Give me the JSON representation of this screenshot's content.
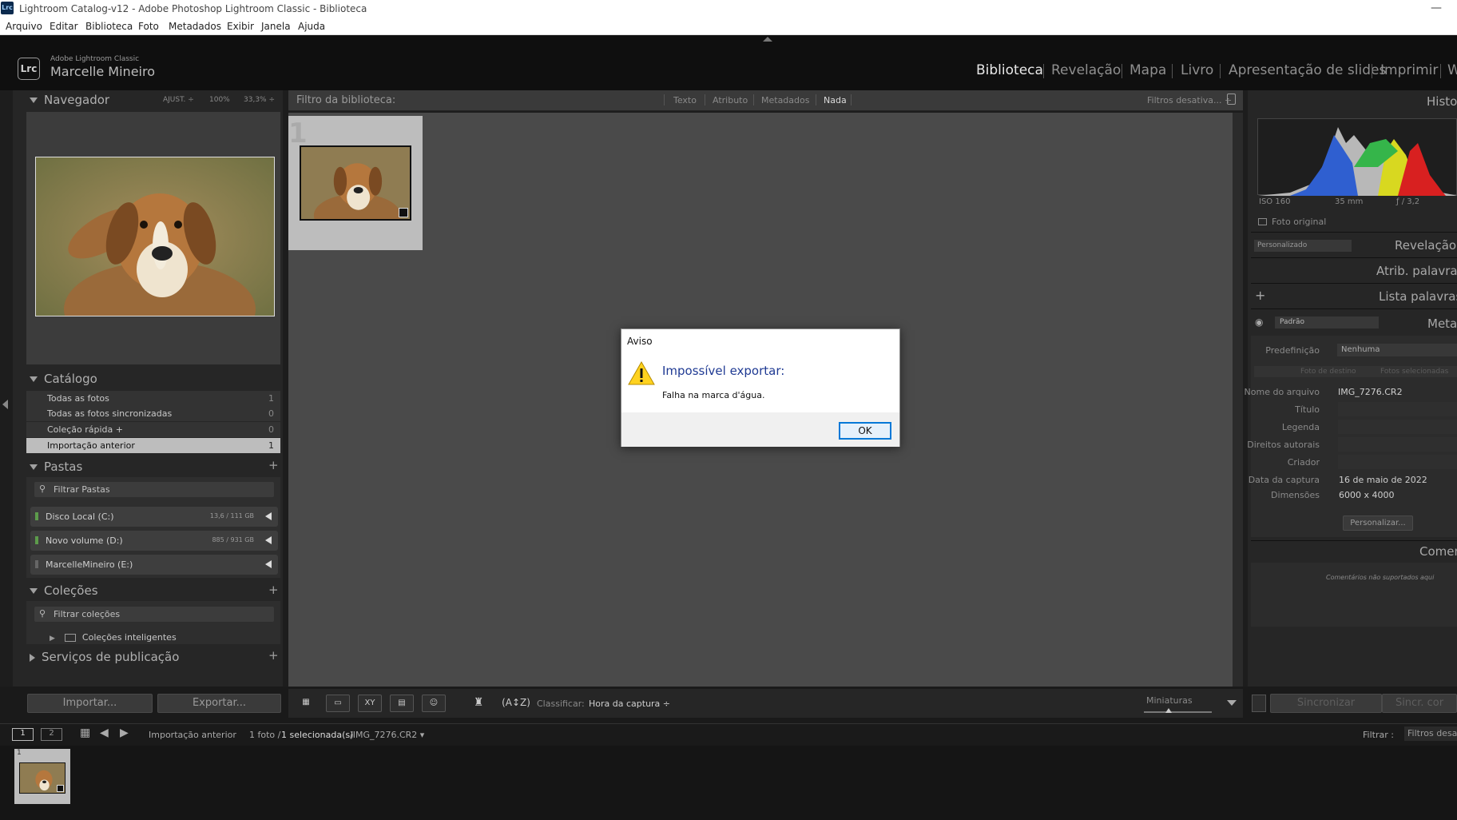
{
  "window": {
    "title": "Lightroom Catalog-v12 - Adobe Photoshop Lightroom Classic - Biblioteca",
    "app_badge": "Lrc",
    "minimize": "—"
  },
  "menu": [
    "Arquivo",
    "Editar",
    "Biblioteca",
    "Foto",
    "Metadados",
    "Exibir",
    "Janela",
    "Ajuda"
  ],
  "identity": {
    "logo": "Lrc",
    "product": "Adobe Lightroom Classic",
    "user": "Marcelle Mineiro"
  },
  "modules": [
    "Biblioteca",
    "Revelação",
    "Mapa",
    "Livro",
    "Apresentação de slides",
    "Imprimir",
    "W"
  ],
  "navigator": {
    "title": "Navegador",
    "zoom_fit": "AJUST. ÷",
    "zoom_100": "100%",
    "zoom_custom": "33,3% ÷"
  },
  "catalog": {
    "title": "Catálogo",
    "items": [
      {
        "label": "Todas as fotos",
        "count": "1"
      },
      {
        "label": "Todas as fotos sincronizadas",
        "count": "0"
      },
      {
        "label": "Coleção rápida  +",
        "count": "0"
      },
      {
        "label": "Importação anterior",
        "count": "1"
      }
    ]
  },
  "folders": {
    "title": "Pastas",
    "filter_placeholder": "Filtrar Pastas",
    "drives": [
      {
        "name": "Disco Local (C:)",
        "size": "13,6 / 111 GB"
      },
      {
        "name": "Novo volume (D:)",
        "size": "885 / 931 GB"
      },
      {
        "name": "MarcelleMineiro (E:)",
        "size": ""
      }
    ]
  },
  "collections": {
    "title": "Coleções",
    "filter_placeholder": "Filtrar coleções",
    "smart": "Coleções inteligentes"
  },
  "publish": {
    "title": "Serviços de publicação"
  },
  "left_buttons": {
    "import": "Importar...",
    "export": "Exportar..."
  },
  "filterbar": {
    "label": "Filtro da biblioteca:",
    "tabs": [
      "Texto",
      "Atributo",
      "Metadados",
      "Nada"
    ],
    "active": "Nada",
    "presets": "Filtros desativa... ÷"
  },
  "grid": {
    "index": "1"
  },
  "toolbar": {
    "sort_label": "Classificar:",
    "sort_value": "Hora da captura ÷",
    "thumbs_label": "Miniaturas"
  },
  "histogram": {
    "title": "Histog",
    "iso": "ISO 160",
    "focal": "35 mm",
    "aperture": "ƒ / 3,2",
    "original": "Foto original"
  },
  "quick_develop": {
    "preset": "Personalizado",
    "title": "Revelação r"
  },
  "keywording": {
    "title": "Atrib. palavras-c"
  },
  "keyword_list": {
    "title": "Lista palavras-c",
    "add": "+"
  },
  "metadata": {
    "title": "Meta",
    "preset_select": "Padrão",
    "preset_label": "Predefinição",
    "preset_value": "Nenhuma",
    "target_photo": "Foto de destino",
    "selected_photos": "Fotos selecionadas",
    "fields": [
      {
        "label": "Nome do arquivo",
        "value": "IMG_7276.CR2"
      },
      {
        "label": "Título",
        "value": ""
      },
      {
        "label": "Legenda",
        "value": ""
      },
      {
        "label": "Direitos autorais",
        "value": ""
      },
      {
        "label": "Criador",
        "value": ""
      },
      {
        "label": "Data da captura",
        "value": "16 de maio de 2022"
      },
      {
        "label": "Dimensões",
        "value": "6000 x 4000"
      }
    ],
    "customize": "Personalizar..."
  },
  "comments": {
    "title": "Comen",
    "empty": "Comentários não suportados aqui"
  },
  "right_buttons": {
    "sync": "Sincronizar",
    "sync2": "Sincr. cor"
  },
  "filmstrip": {
    "page1": "1",
    "page2": "2",
    "source": "Importação anterior",
    "count": "1 foto /",
    "selection": "1 selecionada(s)",
    "file": "/IMG_7276.CR2 ▾",
    "filter_label": "Filtrar :",
    "filter_value": "Filtros desat",
    "thumb_index": "1"
  },
  "dialog": {
    "title": "Aviso",
    "heading": "Impossível exportar:",
    "message": "Falha na marca d'água.",
    "ok": "OK"
  },
  "colors": {
    "accent_dialog": "#1f3a93",
    "ok_border": "#0078d7",
    "selected_row": "#bdbdbd"
  }
}
